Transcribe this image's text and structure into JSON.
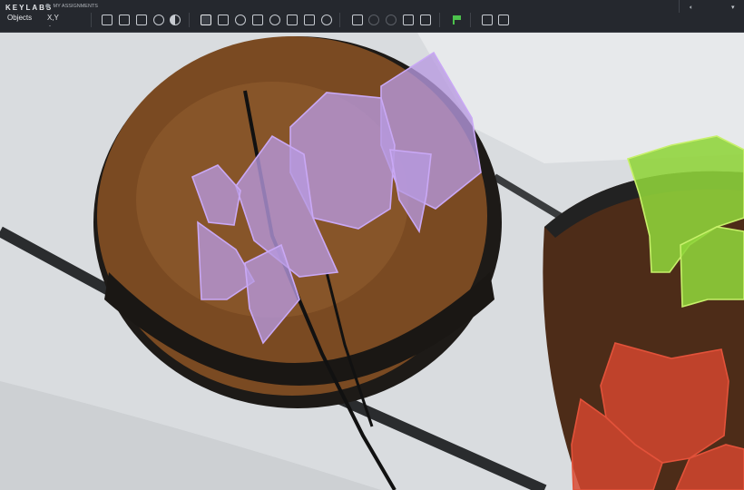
{
  "app": {
    "brand": "KEYLABS",
    "assignments_label": "MY ASSIGNMENTS"
  },
  "tabs": {
    "objects": "Objects",
    "xy": "X,Y",
    "xy_sub": "-"
  },
  "toolbar": {
    "tools": [
      "new-object-icon",
      "comment-icon",
      "list-icon",
      "lock-icon",
      "contrast-icon",
      "layers-icon",
      "fit-view-icon",
      "polygon-tool-icon",
      "segment-icon",
      "pattern-icon",
      "magic-tool-icon",
      "square-tool-icon",
      "timer-icon",
      "select-box-icon",
      "undo-icon",
      "redo-icon",
      "pin-icon",
      "ruler-icon",
      "flag-icon",
      "export-icon",
      "share-icon"
    ],
    "flag_color": "#4cc24c"
  },
  "volume_icon": "speaker-icon",
  "menu_caret": "▾",
  "annotations": {
    "classes": [
      {
        "name": "",
        "color": "#9b7fd0"
      },
      {
        "name": "",
        "color": "#8fd43a"
      },
      {
        "name": "",
        "color": "#d8472f"
      }
    ]
  }
}
